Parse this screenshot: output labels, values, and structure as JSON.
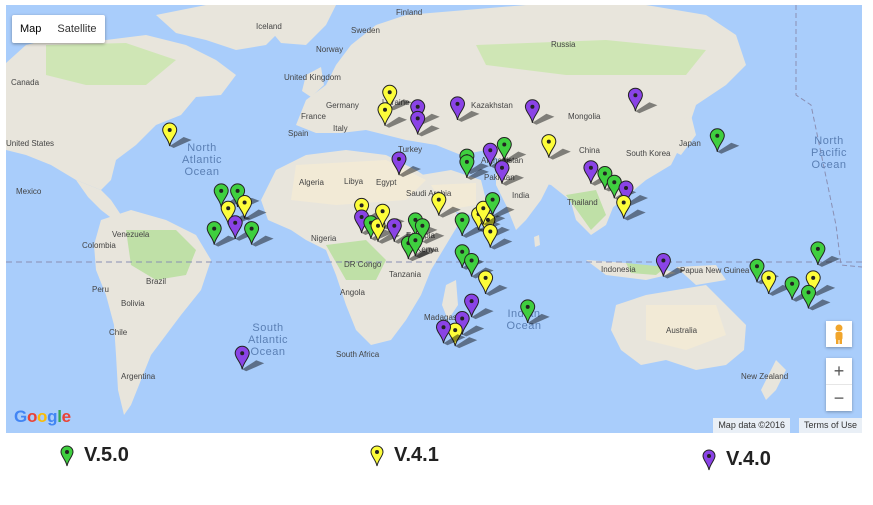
{
  "map_type": {
    "map_label": "Map",
    "satellite_label": "Satellite"
  },
  "countries": [
    "Iceland",
    "Finland",
    "Sweden",
    "Norway",
    "Russia",
    "Canada",
    "United Kingdom",
    "Germany",
    "Ukraine",
    "France",
    "Spain",
    "Italy",
    "Kazakhstan",
    "Mongolia",
    "United States",
    "Turkey",
    "Afghanistan",
    "China",
    "South Korea",
    "Japan",
    "Mexico",
    "Algeria",
    "Libya",
    "Egypt",
    "Saudi Arabia",
    "Pakistan",
    "India",
    "Thailand",
    "Colombia",
    "Venezuela",
    "Ethiopia",
    "Nigeria",
    "Kenya",
    "DR Congo",
    "Tanzania",
    "Indonesia",
    "Papua New Guinea",
    "Peru",
    "Brazil",
    "Angola",
    "Bolivia",
    "Madagascar",
    "Chile",
    "South Africa",
    "Argentina",
    "Australia",
    "New Zealand"
  ],
  "oceans": [
    "North Atlantic Ocean",
    "North Pacific Ocean",
    "South Atlantic Ocean",
    "Indian Ocean"
  ],
  "google_logo": "Google",
  "attribution": {
    "map_data": "Map data ©2016",
    "terms": "Terms of Use"
  },
  "zoom": {
    "in": "+",
    "out": "−"
  },
  "legend": [
    {
      "label": "V.5.0",
      "color": "#3fcf3f"
    },
    {
      "label": "V.4.1",
      "color": "#fdfd3a"
    },
    {
      "label": "V.4.0",
      "color": "#8a43e6"
    }
  ],
  "markers": [
    {
      "v": "V.4.1",
      "lon": -95,
      "lat": 40
    },
    {
      "v": "V.4.1",
      "lon": -1,
      "lat": 53
    },
    {
      "v": "V.4.1",
      "lon": -3,
      "lat": 47
    },
    {
      "v": "V.4.0",
      "lon": 11,
      "lat": 48
    },
    {
      "v": "V.4.0",
      "lon": 11,
      "lat": 44
    },
    {
      "v": "V.4.0",
      "lon": 28,
      "lat": 49
    },
    {
      "v": "V.4.0",
      "lon": 60,
      "lat": 48
    },
    {
      "v": "V.4.0",
      "lon": 104,
      "lat": 52
    },
    {
      "v": "V.5.0",
      "lon": 139,
      "lat": 38
    },
    {
      "v": "V.4.1",
      "lon": 67,
      "lat": 36
    },
    {
      "v": "V.5.0",
      "lon": 48,
      "lat": 35
    },
    {
      "v": "V.4.0",
      "lon": 42,
      "lat": 33
    },
    {
      "v": "V.4.0",
      "lon": 47,
      "lat": 27
    },
    {
      "v": "V.5.0",
      "lon": 32,
      "lat": 31
    },
    {
      "v": "V.5.0",
      "lon": 32,
      "lat": 29
    },
    {
      "v": "V.4.0",
      "lon": 3,
      "lat": 30
    },
    {
      "v": "V.4.0",
      "lon": 85,
      "lat": 27
    },
    {
      "v": "V.5.0",
      "lon": 91,
      "lat": 25
    },
    {
      "v": "V.5.0",
      "lon": 95,
      "lat": 22
    },
    {
      "v": "V.4.0",
      "lon": 100,
      "lat": 20
    },
    {
      "v": "V.4.1",
      "lon": 99,
      "lat": 15
    },
    {
      "v": "V.5.0",
      "lon": -73,
      "lat": 19
    },
    {
      "v": "V.5.0",
      "lon": -66,
      "lat": 19
    },
    {
      "v": "V.4.1",
      "lon": -63,
      "lat": 15
    },
    {
      "v": "V.4.1",
      "lon": -70,
      "lat": 13
    },
    {
      "v": "V.4.0",
      "lon": -67,
      "lat": 8
    },
    {
      "v": "V.5.0",
      "lon": -60,
      "lat": 6
    },
    {
      "v": "V.5.0",
      "lon": -76,
      "lat": 6
    },
    {
      "v": "V.4.1",
      "lon": -13,
      "lat": 14
    },
    {
      "v": "V.4.0",
      "lon": -13,
      "lat": 10
    },
    {
      "v": "V.5.0",
      "lon": -9,
      "lat": 8
    },
    {
      "v": "V.4.1",
      "lon": -6,
      "lat": 7
    },
    {
      "v": "V.4.1",
      "lon": -4,
      "lat": 12
    },
    {
      "v": "V.4.0",
      "lon": 1,
      "lat": 7
    },
    {
      "v": "V.5.0",
      "lon": 10,
      "lat": 9
    },
    {
      "v": "V.5.0",
      "lon": 13,
      "lat": 7
    },
    {
      "v": "V.5.0",
      "lon": 7,
      "lat": 1
    },
    {
      "v": "V.5.0",
      "lon": 10,
      "lat": 2
    },
    {
      "v": "V.4.1",
      "lon": 20,
      "lat": 16
    },
    {
      "v": "V.5.0",
      "lon": 30,
      "lat": 9
    },
    {
      "v": "V.4.1",
      "lon": 37,
      "lat": 11
    },
    {
      "v": "V.4.1",
      "lon": 41,
      "lat": 9
    },
    {
      "v": "V.4.1",
      "lon": 39,
      "lat": 13
    },
    {
      "v": "V.5.0",
      "lon": 43,
      "lat": 16
    },
    {
      "v": "V.4.1",
      "lon": 42,
      "lat": 5
    },
    {
      "v": "V.5.0",
      "lon": 30,
      "lat": -2
    },
    {
      "v": "V.5.0",
      "lon": 34,
      "lat": -5
    },
    {
      "v": "V.4.1",
      "lon": 40,
      "lat": -11
    },
    {
      "v": "V.4.0",
      "lon": 34,
      "lat": -19
    },
    {
      "v": "V.5.0",
      "lon": 58,
      "lat": -21
    },
    {
      "v": "V.4.0",
      "lon": 30,
      "lat": -25
    },
    {
      "v": "V.4.1",
      "lon": 27,
      "lat": -29
    },
    {
      "v": "V.4.0",
      "lon": 22,
      "lat": -28
    },
    {
      "v": "V.4.0",
      "lon": 116,
      "lat": -5
    },
    {
      "v": "V.5.0",
      "lon": 156,
      "lat": -7
    },
    {
      "v": "V.4.1",
      "lon": 161,
      "lat": -11
    },
    {
      "v": "V.5.0",
      "lon": 171,
      "lat": -13
    },
    {
      "v": "V.4.1",
      "lon": 180,
      "lat": -11
    },
    {
      "v": "V.5.0",
      "lon": 178,
      "lat": -16
    },
    {
      "v": "V.5.0",
      "lon": 182,
      "lat": -1
    },
    {
      "v": "V.4.0",
      "lon": -64,
      "lat": -37
    }
  ]
}
